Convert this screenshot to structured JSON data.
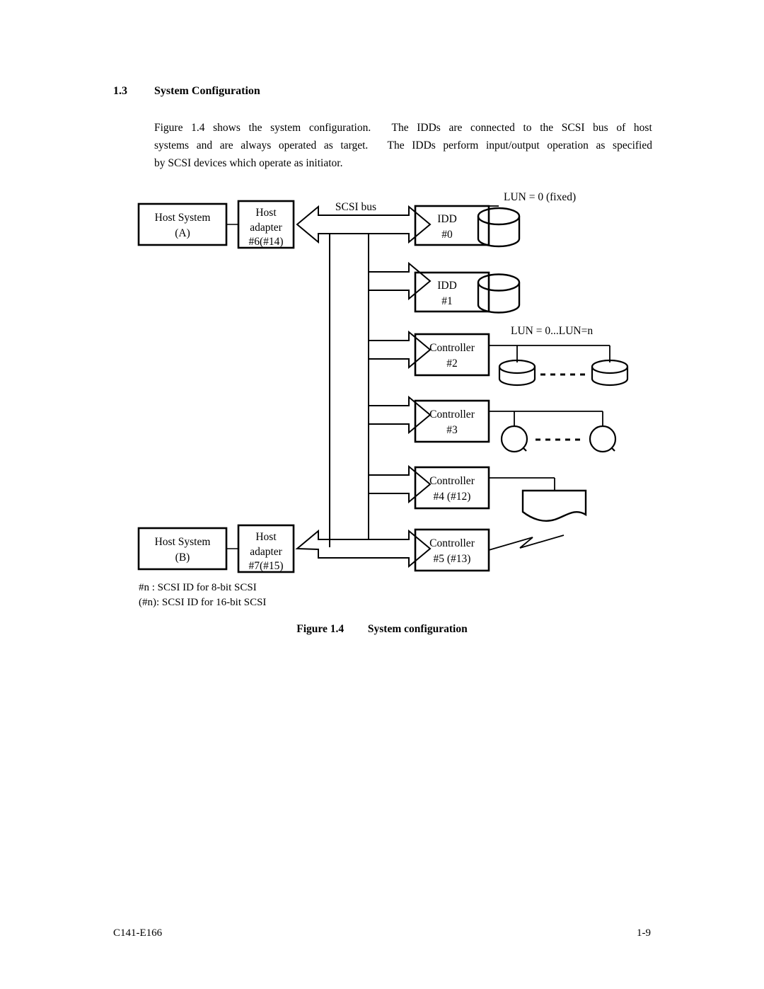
{
  "section": {
    "number": "1.3",
    "title": "System Configuration"
  },
  "paragraph": {
    "line1": "Figure 1.4 shows the system configuration.   The IDDs are connected to the SCSI bus of host",
    "line2": "systems and are always operated as target.  The IDDs perform input/output operation as specified",
    "line3": "by SCSI devices which operate as initiator.",
    "l1w": [
      "Figure",
      "1.4",
      "shows",
      "the",
      "system",
      "configuration.",
      "",
      "The",
      "IDDs",
      "are",
      "connected",
      "to",
      "the",
      "SCSI",
      "bus",
      "of",
      "host"
    ],
    "l2w": [
      "systems",
      "and",
      "are",
      "always",
      "operated",
      "as",
      "target.",
      "",
      "The",
      "IDDs",
      "perform",
      "input/output",
      "operation",
      "as",
      "specified"
    ]
  },
  "diagram": {
    "bus_label": "SCSI bus",
    "hosts": [
      {
        "id": "host-a",
        "line1": "Host System",
        "line2": "(A)"
      },
      {
        "id": "host-b",
        "line1": "Host System",
        "line2": "(B)"
      }
    ],
    "adapters": [
      {
        "id": "adapter-a",
        "line1": "Host",
        "line2": "adapter",
        "line3": "#6(#14)"
      },
      {
        "id": "adapter-b",
        "line1": "Host",
        "line2": "adapter",
        "line3": "#7(#15)"
      }
    ],
    "devices": [
      {
        "id": "idd-0",
        "line1": "IDD",
        "line2": "#0",
        "peripheral": "disk-cylinder"
      },
      {
        "id": "idd-1",
        "line1": "IDD",
        "line2": "#1",
        "peripheral": "disk-cylinder"
      },
      {
        "id": "controller-2",
        "line1": "Controller",
        "line2": "#2",
        "peripheral": "flat-disk-pair"
      },
      {
        "id": "controller-3",
        "line1": "Controller",
        "line2": "#3",
        "peripheral": "tape-circle-pair"
      },
      {
        "id": "controller-4",
        "line1": "Controller",
        "line2": "#4 (#12)",
        "peripheral": "document-shape"
      },
      {
        "id": "controller-5",
        "line1": "Controller",
        "line2": "#5 (#13)",
        "peripheral": "break-zigzag"
      }
    ],
    "annotations": {
      "lun_fixed": "LUN = 0 (fixed)",
      "lun_range": "LUN = 0...LUN=n"
    },
    "legend": {
      "line1": "#n :  SCSI ID for 8-bit SCSI",
      "line2": "(#n): SCSI ID for 16-bit SCSI"
    }
  },
  "caption": {
    "figure": "Figure 1.4",
    "title": "System configuration"
  },
  "footer": {
    "doc_id": "C141-E166",
    "page": "1-9"
  },
  "colors": {
    "ink": "#000000",
    "paper": "#ffffff"
  }
}
